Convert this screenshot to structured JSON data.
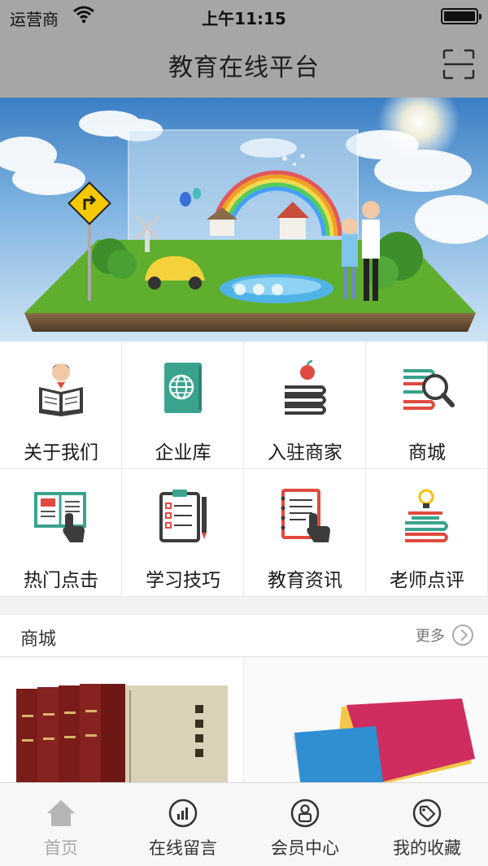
{
  "status": {
    "carrier": "运营商",
    "time": "上午11:15"
  },
  "nav": {
    "title": "教育在线平台"
  },
  "grid": {
    "items": [
      {
        "label": "关于我们",
        "icon": "reading-person-icon"
      },
      {
        "label": "企业库",
        "icon": "globe-book-icon"
      },
      {
        "label": "入驻商家",
        "icon": "apple-books-icon"
      },
      {
        "label": "商城",
        "icon": "books-magnifier-icon"
      },
      {
        "label": "热门点击",
        "icon": "book-hand-icon"
      },
      {
        "label": "学习技巧",
        "icon": "clipboard-pencil-icon"
      },
      {
        "label": "教育资讯",
        "icon": "notebook-hand-icon"
      },
      {
        "label": "老师点评",
        "icon": "lightbulb-books-icon"
      }
    ]
  },
  "shop": {
    "title": "商城",
    "more": "更多"
  },
  "tabbar": {
    "items": [
      {
        "label": "首页",
        "icon": "home-icon"
      },
      {
        "label": "在线留言",
        "icon": "chart-circle-icon"
      },
      {
        "label": "会员中心",
        "icon": "member-icon"
      },
      {
        "label": "我的收藏",
        "icon": "tag-icon"
      }
    ]
  },
  "colors": {
    "topbar": "#a6a6a6",
    "teal": "#3aa38e",
    "red": "#e04a3f",
    "dark": "#3c3c3c"
  }
}
